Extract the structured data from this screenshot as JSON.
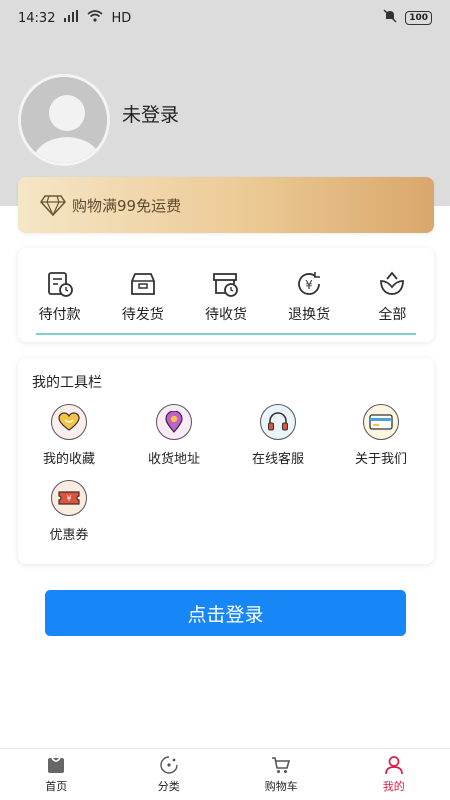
{
  "status_bar": {
    "time": "14:32",
    "network": "HD",
    "battery": "100"
  },
  "profile": {
    "login_status": "未登录",
    "avatar_icon": "default-avatar-icon"
  },
  "vip_banner": {
    "text": "购物满99免运费",
    "icon": "diamond-icon"
  },
  "orders": [
    {
      "label": "待付款",
      "icon": "pending-payment-icon"
    },
    {
      "label": "待发货",
      "icon": "pending-shipment-icon"
    },
    {
      "label": "待收货",
      "icon": "pending-receipt-icon"
    },
    {
      "label": "退换货",
      "icon": "return-exchange-icon"
    },
    {
      "label": "全部",
      "icon": "all-orders-icon"
    }
  ],
  "tools": {
    "title": "我的工具栏",
    "items": [
      {
        "label": "我的收藏",
        "icon": "favorites-icon",
        "color": "#f6c343"
      },
      {
        "label": "收货地址",
        "icon": "address-pin-icon",
        "color": "#c45ecf"
      },
      {
        "label": "在线客服",
        "icon": "headset-icon",
        "color": "#4aa3df"
      },
      {
        "label": "关于我们",
        "icon": "card-icon",
        "color": "#4aa3df"
      },
      {
        "label": "优惠券",
        "icon": "coupon-icon",
        "color": "#e0523a"
      }
    ]
  },
  "login_button": {
    "label": "点击登录",
    "color": "#1787f7"
  },
  "tabbar": [
    {
      "label": "首页",
      "icon": "home-icon",
      "active": false
    },
    {
      "label": "分类",
      "icon": "category-icon",
      "active": false
    },
    {
      "label": "购物车",
      "icon": "cart-icon",
      "active": false
    },
    {
      "label": "我的",
      "icon": "profile-icon",
      "active": true
    }
  ],
  "accent_color": "#d81e4c"
}
